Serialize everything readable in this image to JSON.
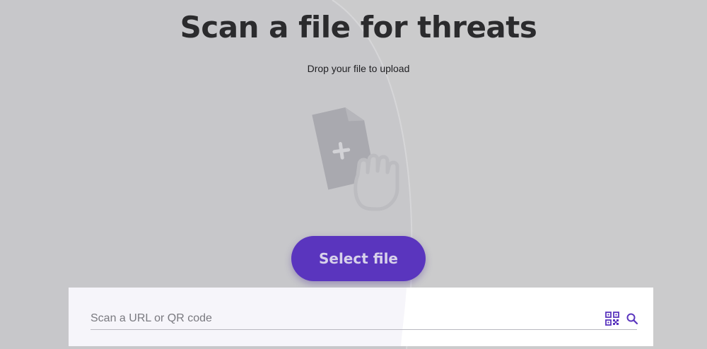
{
  "hero": {
    "title": "Scan a file for threats",
    "subtitle": "Drop your file to upload"
  },
  "upload": {
    "illustration_icon": "file-plus-hand-icon",
    "select_button_label": "Select file"
  },
  "url_scan": {
    "placeholder": "Scan a URL or QR code",
    "value": "",
    "qr_icon": "qr-code-icon",
    "search_icon": "search-icon"
  },
  "colors": {
    "background": "#cbcbcc",
    "accent": "#5a35be",
    "title_text": "#2b2b2d",
    "panel_background": "#f6f5fa"
  }
}
